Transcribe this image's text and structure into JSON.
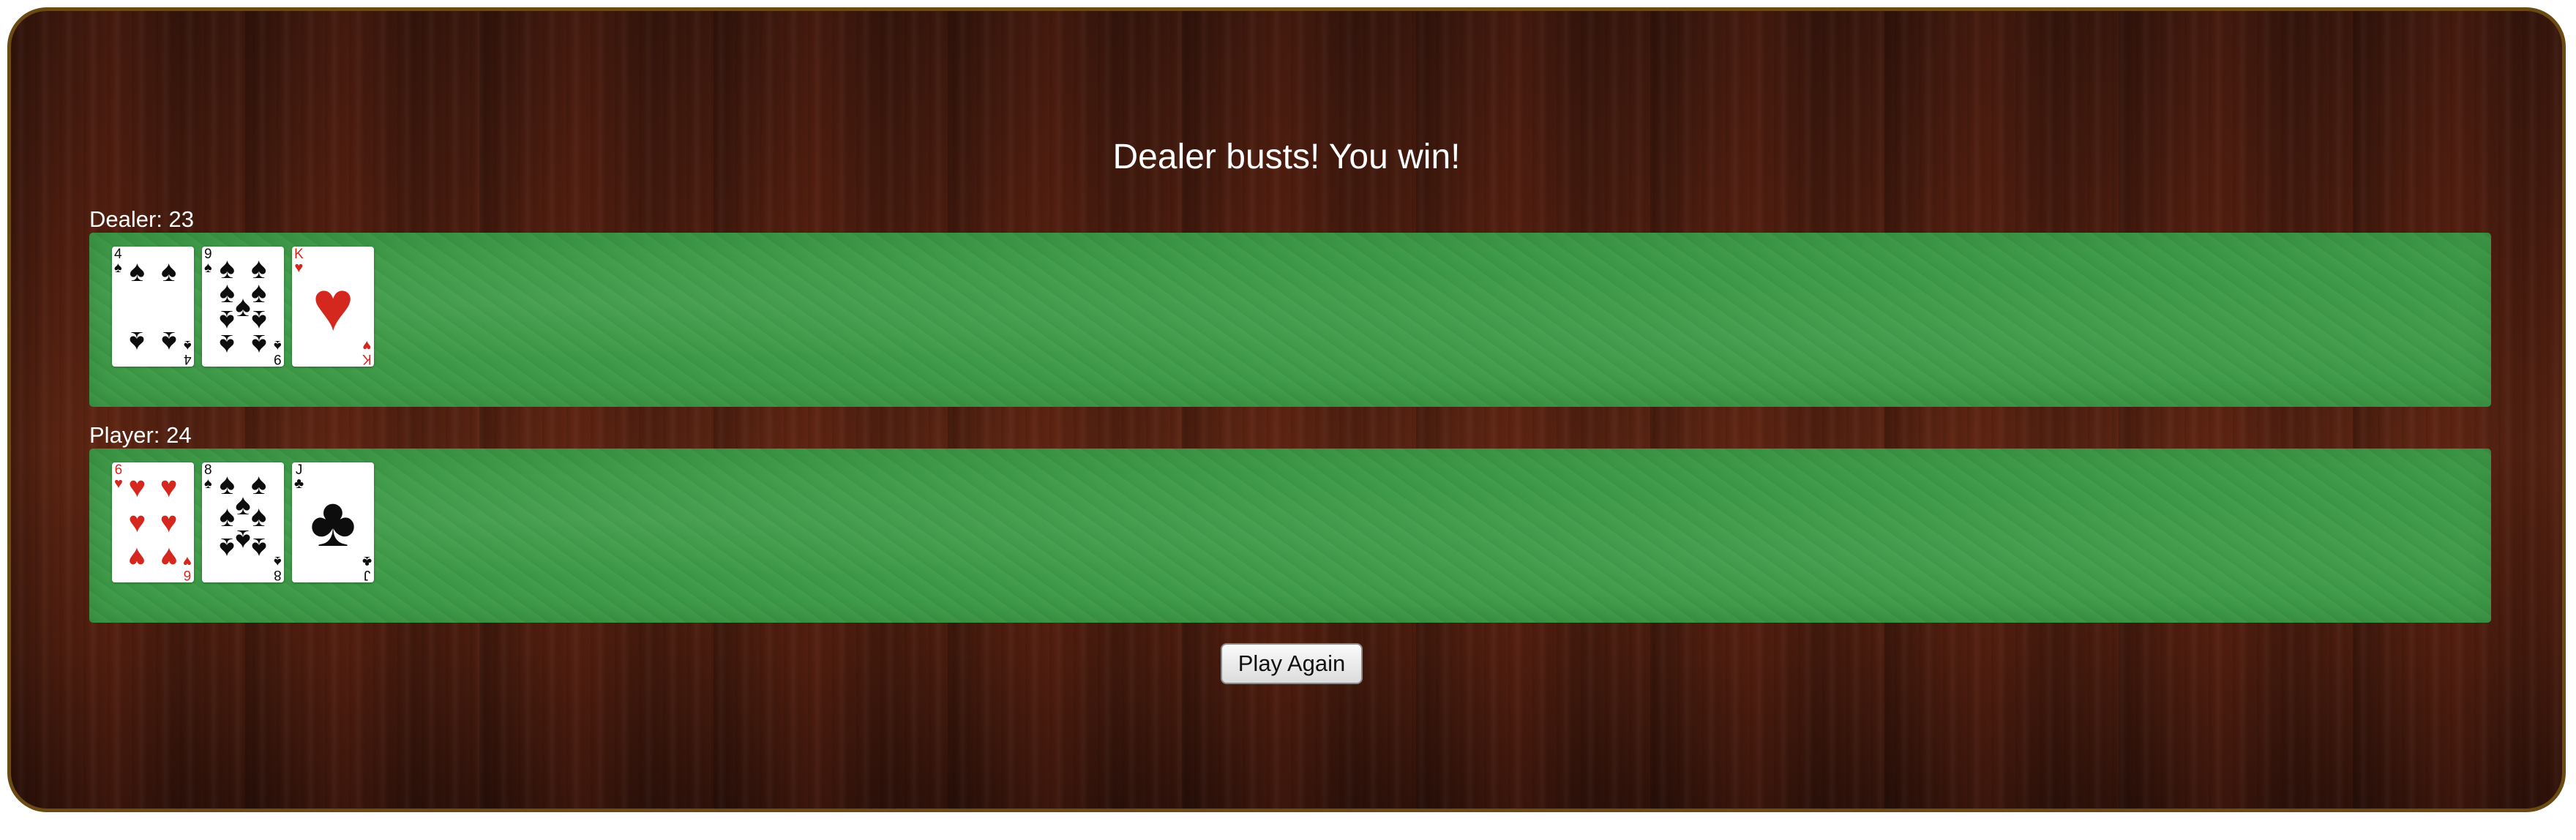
{
  "status_message": "Dealer busts! You win!",
  "dealer": {
    "label": "Dealer: 23",
    "cards": [
      {
        "rank": "4",
        "suit_icon": "spade-icon",
        "suit_glyph": "♠",
        "color": "black"
      },
      {
        "rank": "9",
        "suit_icon": "spade-icon",
        "suit_glyph": "♠",
        "color": "black"
      },
      {
        "rank": "K",
        "suit_icon": "heart-icon",
        "suit_glyph": "♥",
        "color": "red"
      }
    ]
  },
  "player": {
    "label": "Player: 24",
    "cards": [
      {
        "rank": "6",
        "suit_icon": "heart-icon",
        "suit_glyph": "♥",
        "color": "red"
      },
      {
        "rank": "8",
        "suit_icon": "spade-icon",
        "suit_glyph": "♠",
        "color": "black"
      },
      {
        "rank": "J",
        "suit_icon": "club-icon",
        "suit_glyph": "♣",
        "color": "black"
      }
    ]
  },
  "play_again_label": "Play Again",
  "colors": {
    "felt": "#3d9a47",
    "table_border": "#6b4a14",
    "red_suit": "#d4281f",
    "black_suit": "#0d0d0d"
  }
}
